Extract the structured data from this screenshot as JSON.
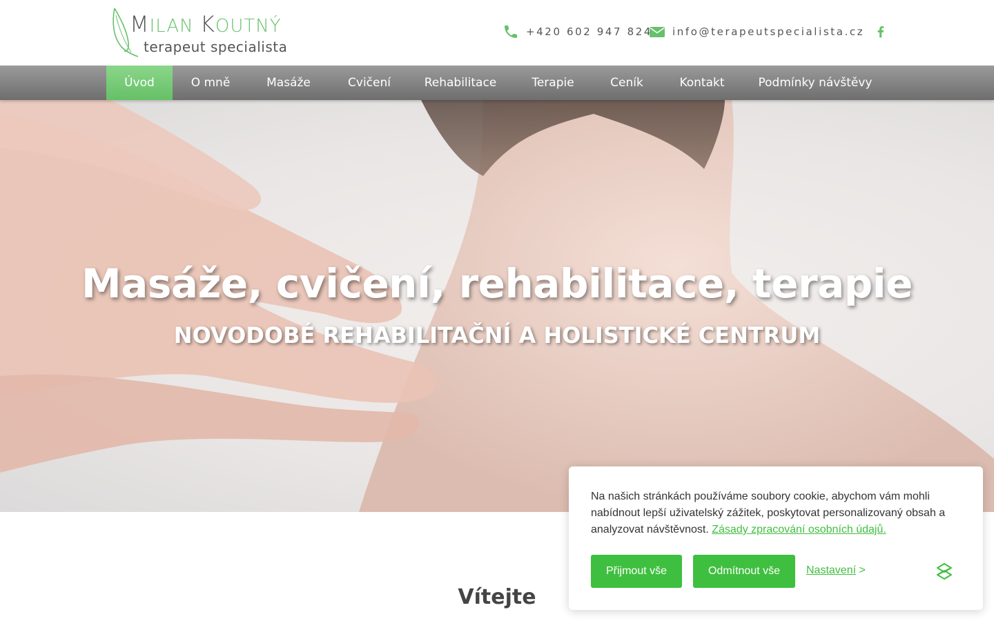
{
  "header": {
    "logo_name_first_initial": "M",
    "logo_name_first_rest": "ILAN",
    "logo_name_last_initial": "K",
    "logo_name_last_rest": "OUTNÝ",
    "logo_subtitle": "terapeut specialista",
    "phone": "+420 602 947 824",
    "email": "info@terapeutspecialista.cz",
    "icons": [
      "phone-icon",
      "envelope-icon",
      "facebook-icon"
    ]
  },
  "nav": {
    "items": [
      {
        "label": "Úvod",
        "active": true
      },
      {
        "label": "O mně",
        "active": false
      },
      {
        "label": "Masáže",
        "active": false
      },
      {
        "label": "Cvičení",
        "active": false
      },
      {
        "label": "Rehabilitace",
        "active": false
      },
      {
        "label": "Terapie",
        "active": false
      },
      {
        "label": "Ceník",
        "active": false
      },
      {
        "label": "Kontakt",
        "active": false
      },
      {
        "label": "Podmínky návštěvy",
        "active": false
      }
    ]
  },
  "hero": {
    "title": "Masáže, cvičení, rehabilitace, terapie",
    "subtitle": "NOVODOBÉ REHABILITAČNÍ A HOLISTICKÉ CENTRUM"
  },
  "main": {
    "heading": "Vítejte"
  },
  "cookie": {
    "text": "Na našich stránkách používáme soubory cookie, abychom vám mohli nabídnout lepší uživatelský zážitek, poskytovat personalizovaný obsah a analyzovat návštěvnost.",
    "policy_link": "Zásady zpracování osobních údajů.",
    "accept_label": "Přijmout vše",
    "reject_label": "Odmítnout vše",
    "settings_label": "Nastavení",
    "settings_arrow": ">"
  },
  "colors": {
    "accent_green": "#3fbf3f",
    "nav_active": "#7acb79",
    "nav_bg": "#858585",
    "brand_leaf": "#67c06b"
  }
}
